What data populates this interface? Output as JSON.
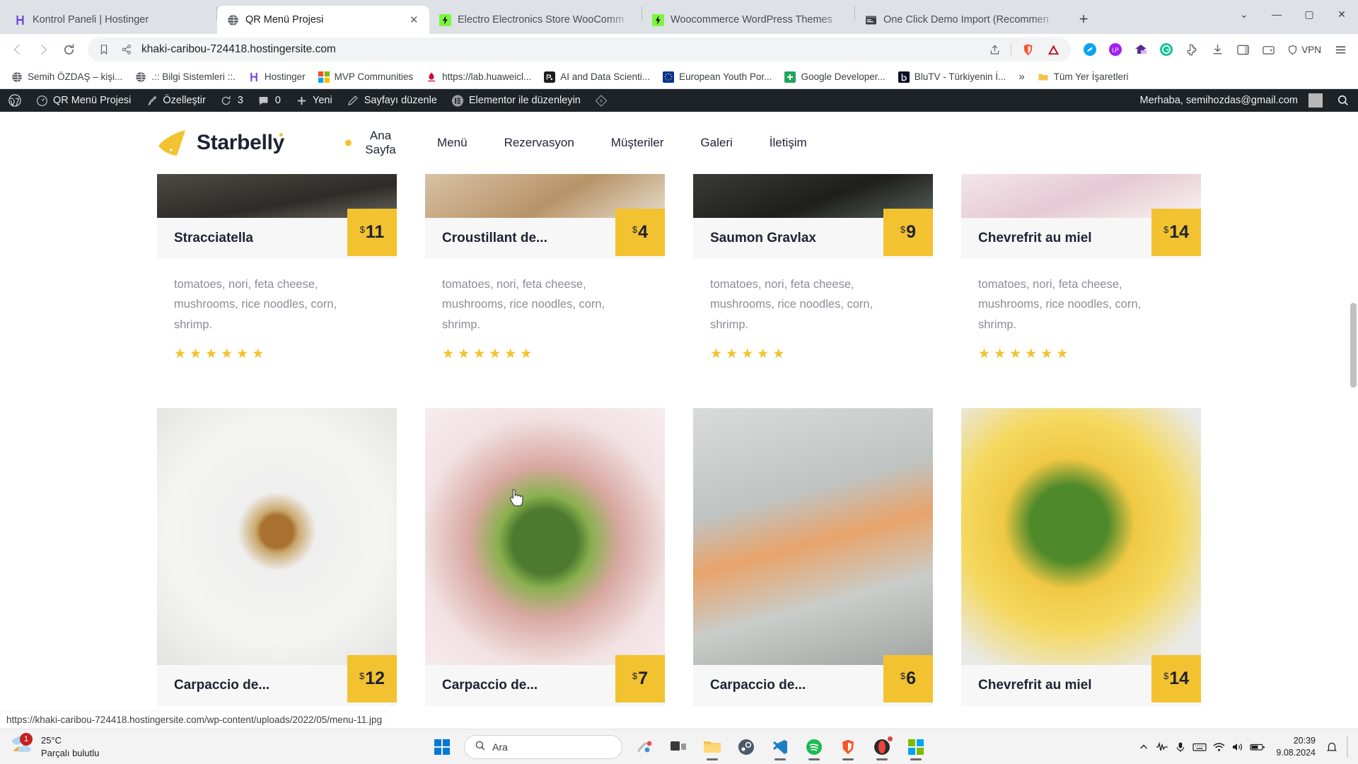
{
  "browser": {
    "tabs": [
      {
        "title": "Kontrol Paneli | Hostinger",
        "favicon": "hostinger-icon",
        "active": false
      },
      {
        "title": "QR Menü Projesi",
        "favicon": "globe-icon",
        "active": true
      },
      {
        "title": "Electro Electronics Store WooComm",
        "favicon": "bolt-icon",
        "active": false
      },
      {
        "title": "Woocommerce WordPress Themes",
        "favicon": "bolt-icon",
        "active": false
      },
      {
        "title": "One Click Demo Import (Recommen",
        "favicon": "window-icon",
        "active": false
      }
    ],
    "new_tab_label": "+",
    "window_controls": {
      "chevron": "⌄",
      "minimize": "—",
      "maximize": "▢",
      "close": "✕"
    },
    "nav": {
      "back": "back-icon",
      "forward": "forward-icon",
      "reload": "reload-icon"
    },
    "omnibox": {
      "url": "khaki-caribou-724418.hostingersite.com",
      "site_icon": "share-site-icon",
      "bookmark_icon": "bookmark-icon",
      "share_icon": "share-icon",
      "brave_icon": "brave-shields-icon",
      "adblock_icon": "adblock-icon"
    },
    "vpn_label": "VPN",
    "bookmarks": [
      {
        "label": "Semih ÖZDAŞ – kişi...",
        "icon": "globe-icon",
        "color": "#4d5156"
      },
      {
        "label": ".:: Bilgi Sistemleri ::.",
        "icon": "globe-icon",
        "color": "#4d5156"
      },
      {
        "label": "Hostinger",
        "icon": "hostinger-icon",
        "color": "#673de6"
      },
      {
        "label": "MVP Communities",
        "icon": "microsoft-icon",
        "color": "#f25022"
      },
      {
        "label": "https://lab.huaweicl...",
        "icon": "huawei-icon",
        "color": "#cf0a2c"
      },
      {
        "label": "AI and Data Scienti...",
        "icon": "square-dark-icon",
        "color": "#1c1c1c"
      },
      {
        "label": "European Youth Por...",
        "icon": "eu-icon",
        "color": "#003399"
      },
      {
        "label": "Google Developer...",
        "icon": "green-plus-icon",
        "color": "#22a45d"
      },
      {
        "label": "BluTV - Türkiyenin İ...",
        "icon": "blutv-icon",
        "color": "#0b0b23"
      }
    ],
    "bookmarks_more": "»",
    "bookmarks_folder": "Tüm Yer İşaretleri"
  },
  "adminbar": {
    "wp_logo": "wordpress-icon",
    "items": [
      {
        "label": "QR Menü Projesi",
        "icon": "dashboard-icon"
      },
      {
        "label": "Özelleştir",
        "icon": "brush-icon"
      },
      {
        "label": "3",
        "icon": "updates-icon"
      },
      {
        "label": "0",
        "icon": "comment-icon"
      },
      {
        "label": "Yeni",
        "icon": "plus-icon"
      },
      {
        "label": "Sayfayı düzenle",
        "icon": "pencil-icon"
      },
      {
        "label": "Elementor ile düzenleyin",
        "icon": "elementor-icon"
      },
      {
        "label": "",
        "icon": "diamond-icon"
      }
    ],
    "greeting": "Merhaba, semihozdas@gmail.com",
    "search_icon": "search-icon"
  },
  "site": {
    "logo_text": "Starbelly",
    "logo_mark": "triangle-mark-icon",
    "nav": [
      {
        "label": "Ana Sayfa",
        "active": true
      },
      {
        "label": "Menü",
        "active": false
      },
      {
        "label": "Rezervasyon",
        "active": false
      },
      {
        "label": "Müşteriler",
        "active": false
      },
      {
        "label": "Galeri",
        "active": false
      },
      {
        "label": "İletişim",
        "active": false
      }
    ],
    "accent_color": "#f2c230",
    "description_text": "tomatoes, nori, feta cheese, mushrooms, rice noodles, corn, shrimp.",
    "cards_row1": [
      {
        "title": "Stracciatella",
        "currency": "$",
        "price": "11",
        "stars": 6,
        "photo": "dark-plate-photo"
      },
      {
        "title": "Croustillant de...",
        "currency": "$",
        "price": "4",
        "stars": 6,
        "photo": "wood-table-photo"
      },
      {
        "title": "Saumon Gravlax",
        "currency": "$",
        "price": "9",
        "stars": 5,
        "photo": "dark-bowl-photo"
      },
      {
        "title": "Chevrefrit au miel",
        "currency": "$",
        "price": "14",
        "stars": 6,
        "photo": "white-plate-photo"
      }
    ],
    "cards_row2": [
      {
        "title": "Carpaccio de...",
        "currency": "$",
        "price": "12",
        "stars": 0,
        "photo": "soup-bowl-photo"
      },
      {
        "title": "Carpaccio de...",
        "currency": "$",
        "price": "7",
        "stars": 0,
        "photo": "noodle-bowl-photo"
      },
      {
        "title": "Carpaccio de...",
        "currency": "$",
        "price": "6",
        "stars": 0,
        "photo": "iced-tea-photo"
      },
      {
        "title": "Chevrefrit au miel",
        "currency": "$",
        "price": "14",
        "stars": 0,
        "photo": "lemonade-photo"
      }
    ]
  },
  "statusbar": {
    "link": "https://khaki-caribou-724418.hostingersite.com/wp-content/uploads/2022/05/menu-11.jpg"
  },
  "taskbar": {
    "weather": {
      "temp": "25°C",
      "condition": "Parçalı bulutlu",
      "badge": "1",
      "icon": "partly-cloudy-icon"
    },
    "start_icon": "windows-start-icon",
    "search_placeholder": "Ara",
    "search_icon": "search-icon",
    "pinned": [
      {
        "name": "snipping-tool-icon"
      },
      {
        "name": "task-view-icon"
      },
      {
        "name": "file-explorer-icon"
      },
      {
        "name": "steam-icon"
      },
      {
        "name": "vscode-icon"
      },
      {
        "name": "spotify-icon"
      },
      {
        "name": "brave-icon"
      },
      {
        "name": "opera-icon"
      },
      {
        "name": "xbox-icon"
      }
    ],
    "tray": {
      "chevron": "chevron-up-icon",
      "equalizer": "equalizer-icon",
      "mic": "mic-icon",
      "keyboard": "keyboard-icon",
      "wifi": "wifi-icon",
      "volume": "volume-icon",
      "battery": "battery-icon",
      "notify": "notification-icon"
    },
    "clock": {
      "time": "20:39",
      "date": "9.08.2024"
    }
  }
}
